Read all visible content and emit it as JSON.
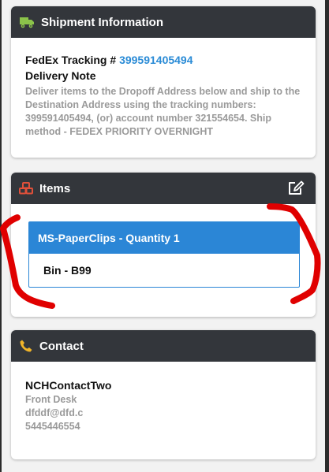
{
  "shipment": {
    "title": "Shipment Information",
    "tracking_label": "FedEx Tracking # ",
    "tracking_number": "399591405494",
    "delivery_title": "Delivery Note",
    "delivery_text": "Deliver items to the Dropoff Address below and ship to the Destination Address using the tracking numbers: 399591405494,  (or) account number 321554654. Ship method - FEDEX PRIORITY OVERNIGHT"
  },
  "items": {
    "title": "Items",
    "list": [
      {
        "name": "MS-PaperClips - Quantity 1",
        "bin": "Bin - B99"
      }
    ]
  },
  "contact": {
    "title": "Contact",
    "name": "NCHContactTwo",
    "role": "Front Desk",
    "email": "dfddf@dfd.c",
    "phone": "5445446554"
  },
  "colors": {
    "header_bg": "#33363b",
    "accent_blue": "#2b86d6",
    "link_blue": "#2a8bd6",
    "muted_text": "#9a9a9a",
    "truck_icon": "#8bc34a",
    "cubes_icon": "#e0503a",
    "phone_icon": "#f0b429",
    "annotation_red": "#e00000"
  }
}
